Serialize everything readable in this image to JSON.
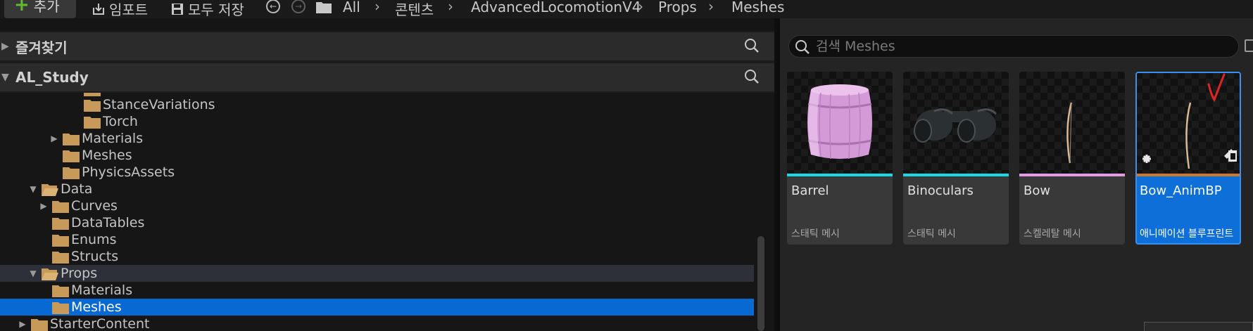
{
  "toolbar": {
    "add_label": "추가",
    "import_label": "임포트",
    "save_all_label": "모두 저장",
    "breadcrumb": [
      "All",
      "콘텐츠",
      "AdvancedLocomotionV4",
      "Props",
      "Meshes"
    ]
  },
  "favorites": {
    "title": "즐겨찾기"
  },
  "project": {
    "title": "AL_Study"
  },
  "tree": [
    {
      "label": "StanceVariations",
      "expand": ""
    },
    {
      "label": "Torch",
      "expand": ""
    },
    {
      "label": "Materials",
      "expand": "collapsed"
    },
    {
      "label": "Meshes",
      "expand": ""
    },
    {
      "label": "PhysicsAssets",
      "expand": ""
    },
    {
      "label": "Data",
      "expand": "expanded"
    },
    {
      "label": "Curves",
      "expand": "collapsed"
    },
    {
      "label": "DataTables",
      "expand": ""
    },
    {
      "label": "Enums",
      "expand": ""
    },
    {
      "label": "Structs",
      "expand": ""
    },
    {
      "label": "Props",
      "expand": "expanded"
    },
    {
      "label": "Materials",
      "expand": ""
    },
    {
      "label": "Meshes",
      "expand": ""
    },
    {
      "label": "StarterContent",
      "expand": "collapsed"
    }
  ],
  "search": {
    "placeholder": "검색 Meshes"
  },
  "assets": [
    {
      "name": "Barrel",
      "type": "스태틱 메시",
      "strip_color": "#19d8e8"
    },
    {
      "name": "Binoculars",
      "type": "스태틱 메시",
      "strip_color": "#19d8e8"
    },
    {
      "name": "Bow",
      "type": "스켈레탈 메시",
      "strip_color": "#e59ae6"
    },
    {
      "name": "Bow_AnimBP",
      "type": "애니메이션 블루프린트",
      "strip_color": "#d0772a"
    }
  ],
  "colors": {
    "selection": "#0969d2",
    "folder": "#c89a5a"
  }
}
